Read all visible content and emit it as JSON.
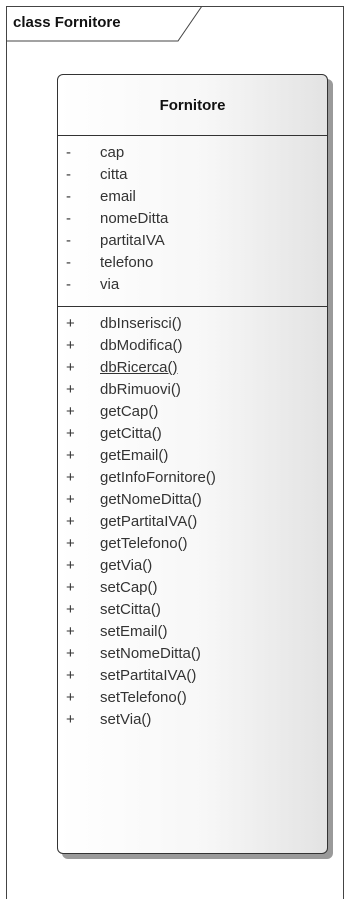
{
  "frame": {
    "title": "class Fornitore"
  },
  "class": {
    "name": "Fornitore",
    "attributes": [
      {
        "visibility": "-",
        "name": "cap"
      },
      {
        "visibility": "-",
        "name": "citta"
      },
      {
        "visibility": "-",
        "name": "email"
      },
      {
        "visibility": "-",
        "name": "nomeDitta"
      },
      {
        "visibility": "-",
        "name": "partitaIVA"
      },
      {
        "visibility": "-",
        "name": "telefono"
      },
      {
        "visibility": "-",
        "name": "via"
      }
    ],
    "operations": [
      {
        "visibility": "+",
        "name": "dbInserisci()",
        "static": false
      },
      {
        "visibility": "+",
        "name": "dbModifica()",
        "static": false
      },
      {
        "visibility": "+",
        "name": "dbRicerca()",
        "static": true
      },
      {
        "visibility": "+",
        "name": "dbRimuovi()",
        "static": false
      },
      {
        "visibility": "+",
        "name": "getCap()",
        "static": false
      },
      {
        "visibility": "+",
        "name": "getCitta()",
        "static": false
      },
      {
        "visibility": "+",
        "name": "getEmail()",
        "static": false
      },
      {
        "visibility": "+",
        "name": "getInfoFornitore()",
        "static": false
      },
      {
        "visibility": "+",
        "name": "getNomeDitta()",
        "static": false
      },
      {
        "visibility": "+",
        "name": "getPartitaIVA()",
        "static": false
      },
      {
        "visibility": "+",
        "name": "getTelefono()",
        "static": false
      },
      {
        "visibility": "+",
        "name": "getVia()",
        "static": false
      },
      {
        "visibility": "+",
        "name": "setCap()",
        "static": false
      },
      {
        "visibility": "+",
        "name": "setCitta()",
        "static": false
      },
      {
        "visibility": "+",
        "name": "setEmail()",
        "static": false
      },
      {
        "visibility": "+",
        "name": "setNomeDitta()",
        "static": false
      },
      {
        "visibility": "+",
        "name": "setPartitaIVA()",
        "static": false
      },
      {
        "visibility": "+",
        "name": "setTelefono()",
        "static": false
      },
      {
        "visibility": "+",
        "name": "setVia()",
        "static": false
      }
    ]
  }
}
